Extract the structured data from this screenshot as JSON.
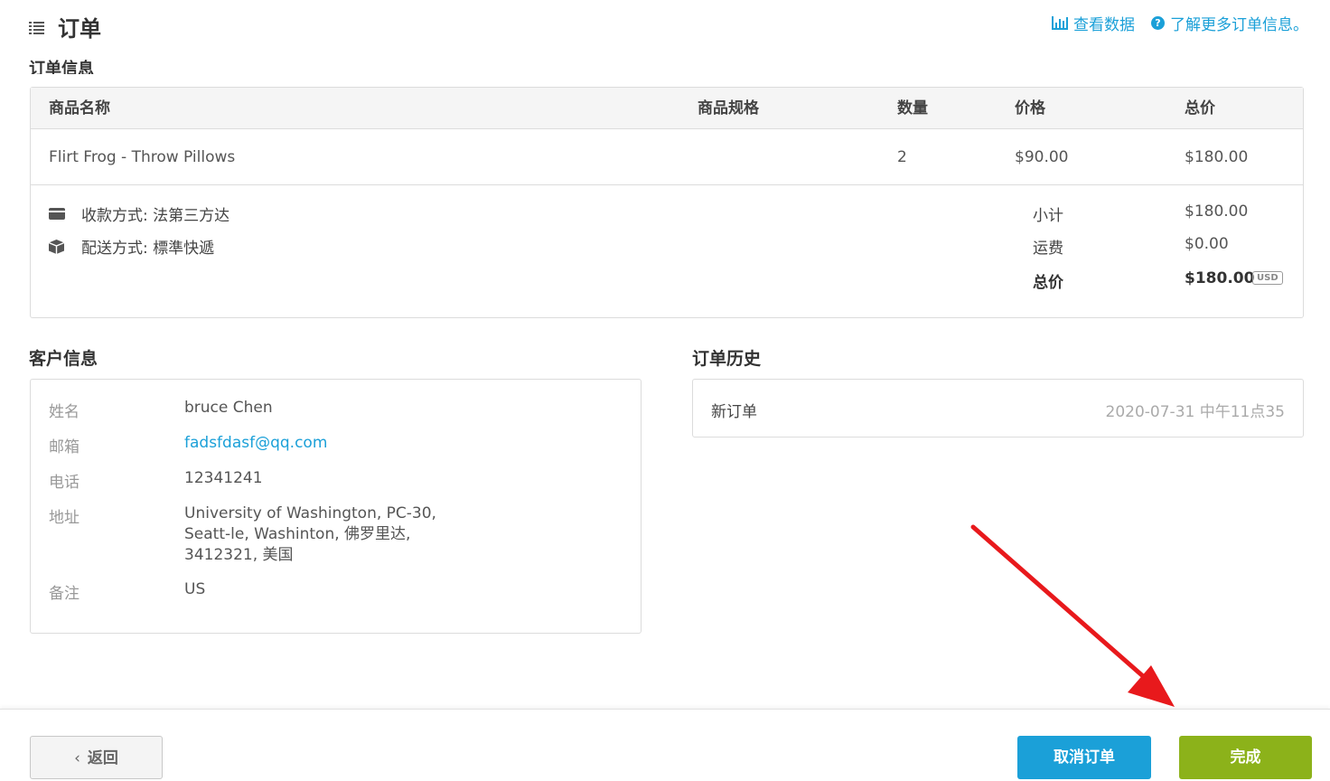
{
  "header": {
    "title": "订单",
    "link_data": "查看数据",
    "link_more": "了解更多订单信息。"
  },
  "order": {
    "section_title": "订单信息",
    "columns": [
      "商品名称",
      "商品规格",
      "数量",
      "价格",
      "总价"
    ],
    "rows": [
      {
        "name": "Flirt Frog - Throw Pillows",
        "spec": "",
        "qty": "2",
        "price": "$90.00",
        "total": "$180.00"
      }
    ],
    "payment": "收款方式: 法第三方达",
    "shipping": "配送方式: 標準快遞",
    "subtotal_label": "小计",
    "subtotal": "$180.00",
    "shipping_fee_label": "运费",
    "shipping_fee": "$0.00",
    "total_label": "总价",
    "total": "$180.00",
    "currency": "USD"
  },
  "customer": {
    "section_title": "客户信息",
    "name_label": "姓名",
    "name": "bruce Chen",
    "email_label": "邮箱",
    "email": "fadsfdasf@qq.com",
    "phone_label": "电话",
    "phone": "12341241",
    "address_label": "地址",
    "address_line1": "University of Washington, PC-30,",
    "address_line2": "Seatt-le, Washinton, 佛罗里达,",
    "address_line3": "3412321, 美国",
    "note_label": "备注",
    "note": "US"
  },
  "history": {
    "section_title": "订单历史",
    "items": [
      {
        "event": "新订单",
        "time": "2020-07-31 中午11点35"
      }
    ]
  },
  "footer": {
    "back": "返回",
    "cancel": "取消订单",
    "done": "完成"
  },
  "colors": {
    "accent": "#1ba0d8",
    "done_button": "#8cb21a",
    "arrow": "#e8191c"
  },
  "icons": [
    "list-icon",
    "bar-chart-icon",
    "question-circle-icon",
    "credit-card-icon",
    "box-icon",
    "chevron-left-icon",
    "red-arrow-annotation"
  ]
}
